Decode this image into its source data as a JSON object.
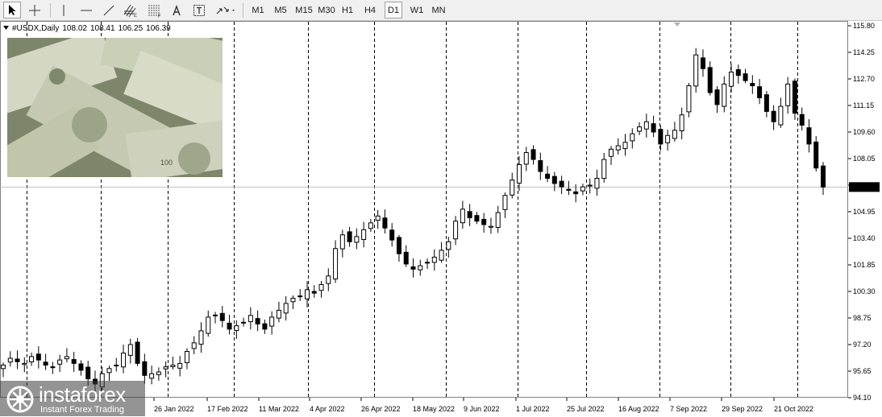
{
  "toolbar": {
    "tools": [
      {
        "name": "cursor-tool-icon",
        "active": true
      },
      {
        "name": "crosshair-tool-icon",
        "active": false
      },
      {
        "name": "vertical-line-tool-icon",
        "active": false
      },
      {
        "name": "horizontal-line-tool-icon",
        "active": false
      },
      {
        "name": "trendline-tool-icon",
        "active": false
      },
      {
        "name": "fibonacci-channels-icon",
        "active": false
      },
      {
        "name": "fibonacci-retracement-icon",
        "active": false
      },
      {
        "name": "text-tool-icon",
        "active": false
      },
      {
        "name": "text-label-tool-icon",
        "active": false
      },
      {
        "name": "arrows-tool-icon",
        "active": false
      }
    ],
    "timeframes": [
      "M1",
      "M5",
      "M15",
      "M30",
      "H1",
      "H4",
      "D1",
      "W1",
      "MN"
    ],
    "active_timeframe": "D1"
  },
  "chart": {
    "symbol": "#USDX,Daily",
    "open": "108.02",
    "high": "108.41",
    "low": "106.25",
    "close": "106.39",
    "current_price_label": "106.39"
  },
  "watermark": {
    "brand": "instaforex",
    "tagline": "Instant Forex Trading"
  },
  "colors": {
    "background": "#ffffff",
    "candle": "#000000",
    "grid_separator": "#000000",
    "toolbar_bg": "#f0f0f0"
  },
  "chart_data": {
    "type": "candlestick",
    "title": "",
    "xlabel": "",
    "ylabel": "",
    "ylim": [
      94.1,
      115.8
    ],
    "y_ticks": [
      "115.80",
      "114.25",
      "112.70",
      "111.15",
      "109.60",
      "108.05",
      "106.50",
      "104.95",
      "103.40",
      "101.85",
      "100.30",
      "98.75",
      "97.20",
      "95.65",
      "94.10"
    ],
    "x_ticks": [
      "26 Jan 2022",
      "17 Feb 2022",
      "11 Mar 2022",
      "4 Apr 2022",
      "26 Apr 2022",
      "18 May 2022",
      "9 Jun 2022",
      "1 Jul 2022",
      "25 Jul 2022",
      "16 Aug 2022",
      "7 Sep 2022",
      "29 Sep 2022",
      "21 Oct 2022"
    ],
    "close_path": [
      96.0,
      96.4,
      96.2,
      96.1,
      96.5,
      96.3,
      96.0,
      95.9,
      96.3,
      96.5,
      96.1,
      95.7,
      95.2,
      94.9,
      95.5,
      95.8,
      96.0,
      96.7,
      97.2,
      96.1,
      95.4,
      95.5,
      95.6,
      95.9,
      96.0,
      96.1,
      96.8,
      97.3,
      98.0,
      98.8,
      98.9,
      98.6,
      98.1,
      98.3,
      98.5,
      98.9,
      98.4,
      98.1,
      98.8,
      99.2,
      99.6,
      99.9,
      100.0,
      100.4,
      100.2,
      100.7,
      101.2,
      102.8,
      103.6,
      103.2,
      103.5,
      103.9,
      104.3,
      104.7,
      104.0,
      103.3,
      102.5,
      101.9,
      101.6,
      101.8,
      102.0,
      102.3,
      102.7,
      103.2,
      104.4,
      105.1,
      104.6,
      104.4,
      104.2,
      104.1,
      104.9,
      105.9,
      106.8,
      107.7,
      108.4,
      108.0,
      107.3,
      106.9,
      106.6,
      106.4,
      106.2,
      106.0,
      106.4,
      106.5,
      106.9,
      108.0,
      108.6,
      108.8,
      109.0,
      109.5,
      109.9,
      110.2,
      109.6,
      108.9,
      109.4,
      109.7,
      110.6,
      112.3,
      114.1,
      113.3,
      111.9,
      111.2,
      112.4,
      113.1,
      112.9,
      112.6,
      112.3,
      111.6,
      110.8,
      110.2,
      111.1,
      112.4,
      110.7,
      110.0,
      108.9,
      107.5,
      106.39
    ]
  }
}
